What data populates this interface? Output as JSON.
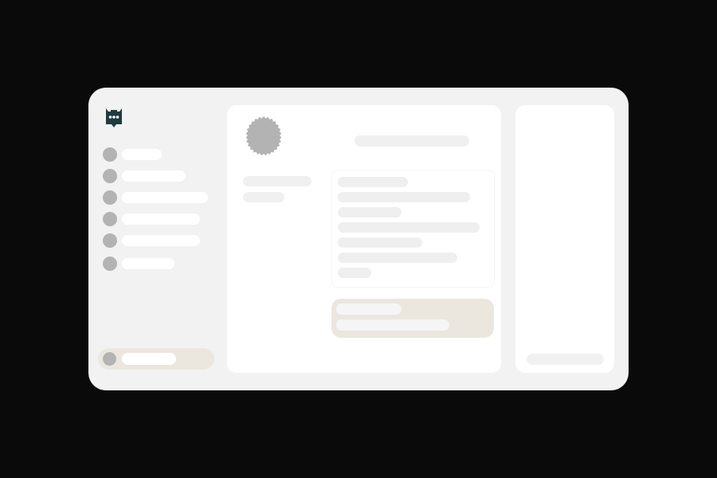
{
  "app": {
    "accent_color": "#1e3b40",
    "window_bg": "#f2f2f2",
    "highlight_bg": "#ebe7df",
    "logo_icon": "chat-bubble-ellipsis-icon"
  },
  "sidebar": {
    "items": [
      {
        "icon": "nav-item-1-icon",
        "label": ""
      },
      {
        "icon": "nav-item-2-icon",
        "label": ""
      },
      {
        "icon": "nav-item-3-icon",
        "label": ""
      },
      {
        "icon": "nav-item-4-icon",
        "label": ""
      },
      {
        "icon": "nav-item-5-icon",
        "label": ""
      },
      {
        "icon": "nav-item-6-icon",
        "label": ""
      }
    ],
    "account": {
      "avatar": "user-avatar-icon",
      "label": ""
    }
  },
  "main": {
    "avatar_icon": "profile-avatar-icon",
    "title": "",
    "meta": {
      "line1": "",
      "line2": ""
    },
    "details": {
      "lines": [
        "",
        "",
        "",
        "",
        "",
        "",
        ""
      ]
    },
    "note": {
      "heading": "",
      "body": ""
    }
  },
  "right_panel": {
    "footer": ""
  }
}
